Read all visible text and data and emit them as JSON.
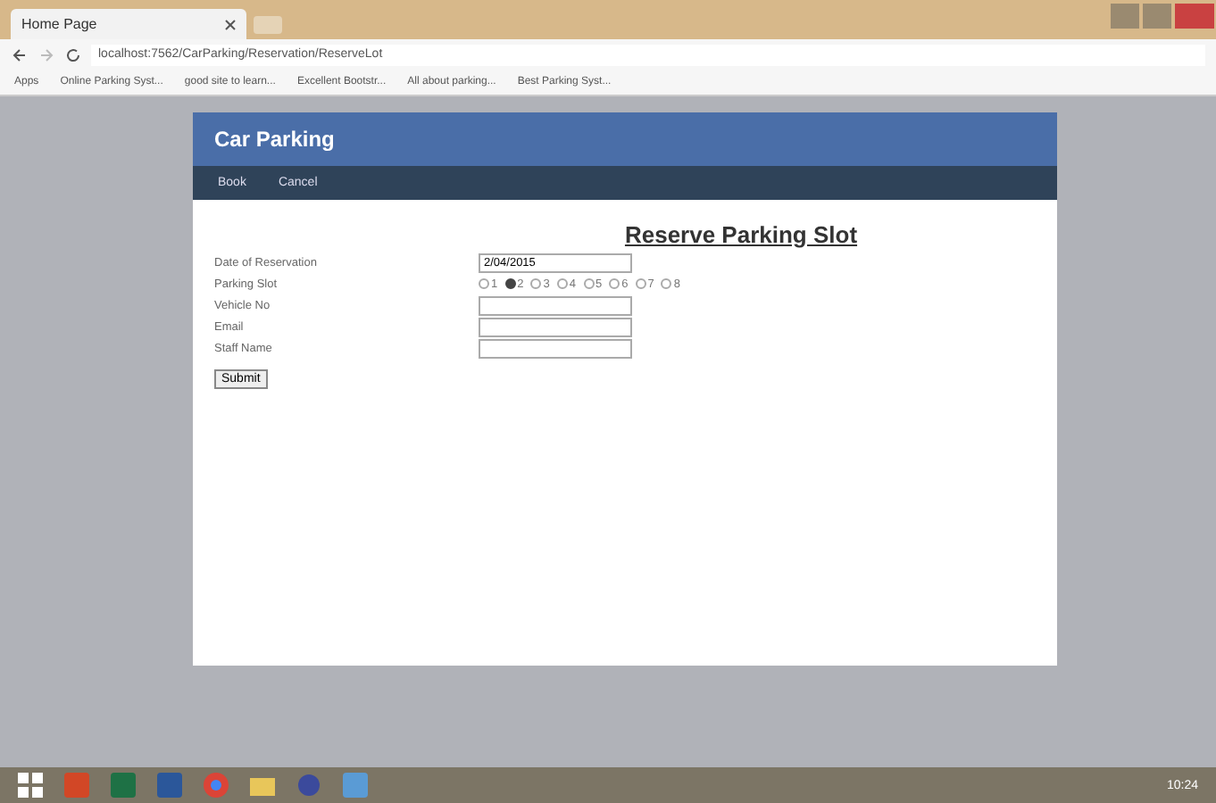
{
  "browser": {
    "tab_title": "Home Page",
    "url": "localhost:7562/CarParking/Reservation/ReserveLot",
    "bookmarks": [
      "Apps",
      "Online Parking Syst...",
      "good site to learn...",
      "Excellent Bootstr...",
      "All about parking...",
      "Best Parking Syst..."
    ]
  },
  "site": {
    "logo": "Car Parking",
    "nav": [
      "Book",
      "Cancel"
    ]
  },
  "form": {
    "title": "Reserve Parking Slot",
    "fields": [
      {
        "kind": "text",
        "label": "Date of Reservation",
        "value": "2/04/2015"
      },
      {
        "kind": "radios",
        "label": "Parking Slot",
        "options": [
          {
            "label": "1",
            "selected": false
          },
          {
            "label": "2",
            "selected": true
          },
          {
            "label": "3",
            "selected": false
          },
          {
            "label": "4",
            "selected": false
          },
          {
            "label": "5",
            "selected": false
          },
          {
            "label": "6",
            "selected": false
          },
          {
            "label": "7",
            "selected": false
          },
          {
            "label": "8",
            "selected": false
          }
        ]
      },
      {
        "kind": "text",
        "label": "Vehicle No"
      },
      {
        "kind": "text",
        "label": "Email"
      },
      {
        "kind": "text",
        "label": "Staff Name"
      }
    ],
    "submit": "Submit"
  },
  "taskbar": {
    "clock": "10:24"
  }
}
